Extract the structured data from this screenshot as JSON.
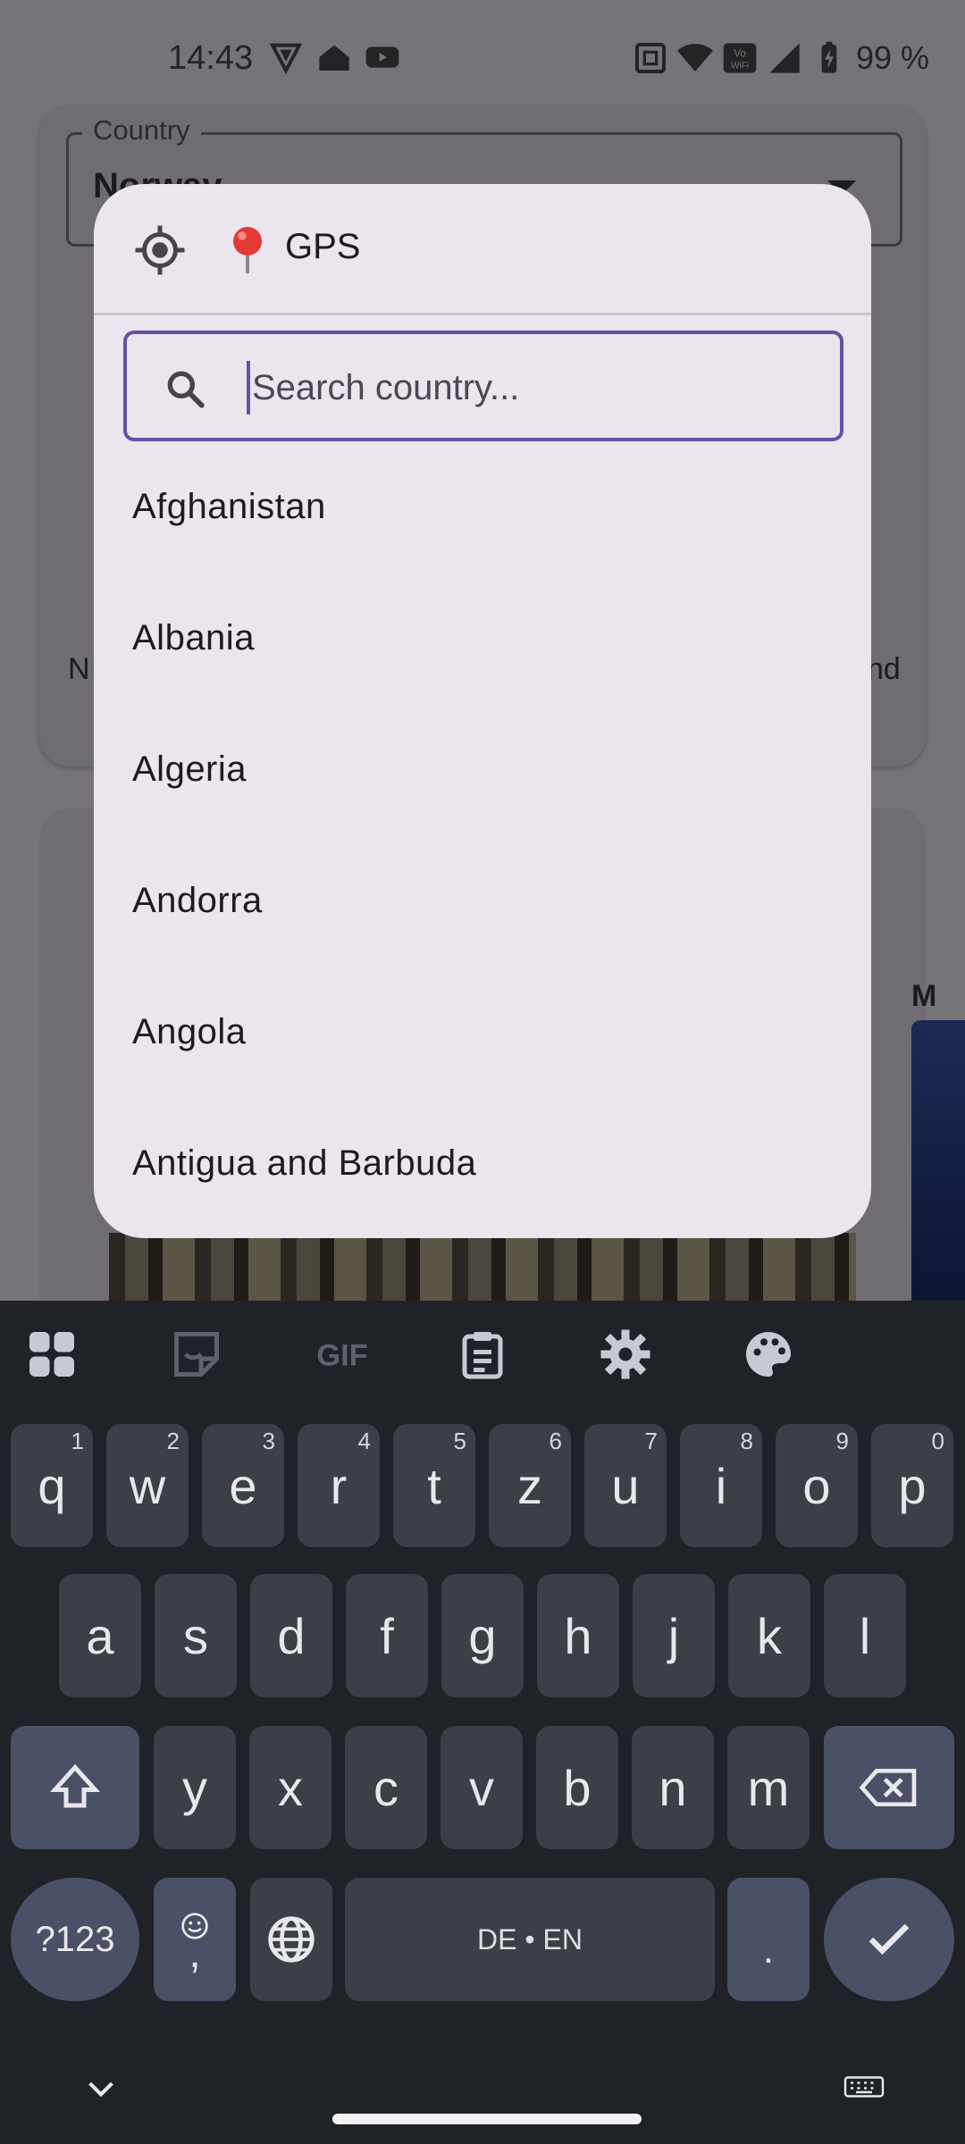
{
  "status_bar": {
    "time": "14:43",
    "battery": "99 %",
    "left_icons": [
      "vpn-shield-icon",
      "home-icon",
      "youtube-icon"
    ],
    "right_icons": [
      "nfc-icon",
      "wifi-icon",
      "vowifi-icon",
      "signal-icon",
      "battery-icon"
    ]
  },
  "background": {
    "country_label": "Country",
    "country_value": "Norway",
    "fragment_left": "N",
    "fragment_right": "nd",
    "fragment_card2": "M"
  },
  "dialog": {
    "gps_label": "GPS",
    "gps_icon": "my-location-icon",
    "pin_icon": "round-pushpin-icon",
    "search": {
      "placeholder": "Search country...",
      "value": ""
    },
    "countries": [
      "Afghanistan",
      "Albania",
      "Algeria",
      "Andorra",
      "Angola",
      "Antigua and Barbuda"
    ]
  },
  "keyboard": {
    "toolbar_icons": [
      "apps-grid-icon",
      "sticker-icon",
      "gif-icon",
      "clipboard-icon",
      "settings-icon",
      "palette-icon"
    ],
    "gif_label": "GIF",
    "row1": [
      {
        "k": "q",
        "h": "1"
      },
      {
        "k": "w",
        "h": "2"
      },
      {
        "k": "e",
        "h": "3"
      },
      {
        "k": "r",
        "h": "4"
      },
      {
        "k": "t",
        "h": "5"
      },
      {
        "k": "z",
        "h": "6"
      },
      {
        "k": "u",
        "h": "7"
      },
      {
        "k": "i",
        "h": "8"
      },
      {
        "k": "o",
        "h": "9"
      },
      {
        "k": "p",
        "h": "0"
      }
    ],
    "row2": [
      "a",
      "s",
      "d",
      "f",
      "g",
      "h",
      "j",
      "k",
      "l"
    ],
    "row3": [
      "y",
      "x",
      "c",
      "v",
      "b",
      "n",
      "m"
    ],
    "symbols_label": "?123",
    "comma_label": ",",
    "space_label": "DE • EN",
    "period_label": ".",
    "colors": {
      "accent": "#6750a4",
      "key": "#3b3f46",
      "func_key": "#4a5066",
      "kb_bg": "#1f2227"
    }
  }
}
